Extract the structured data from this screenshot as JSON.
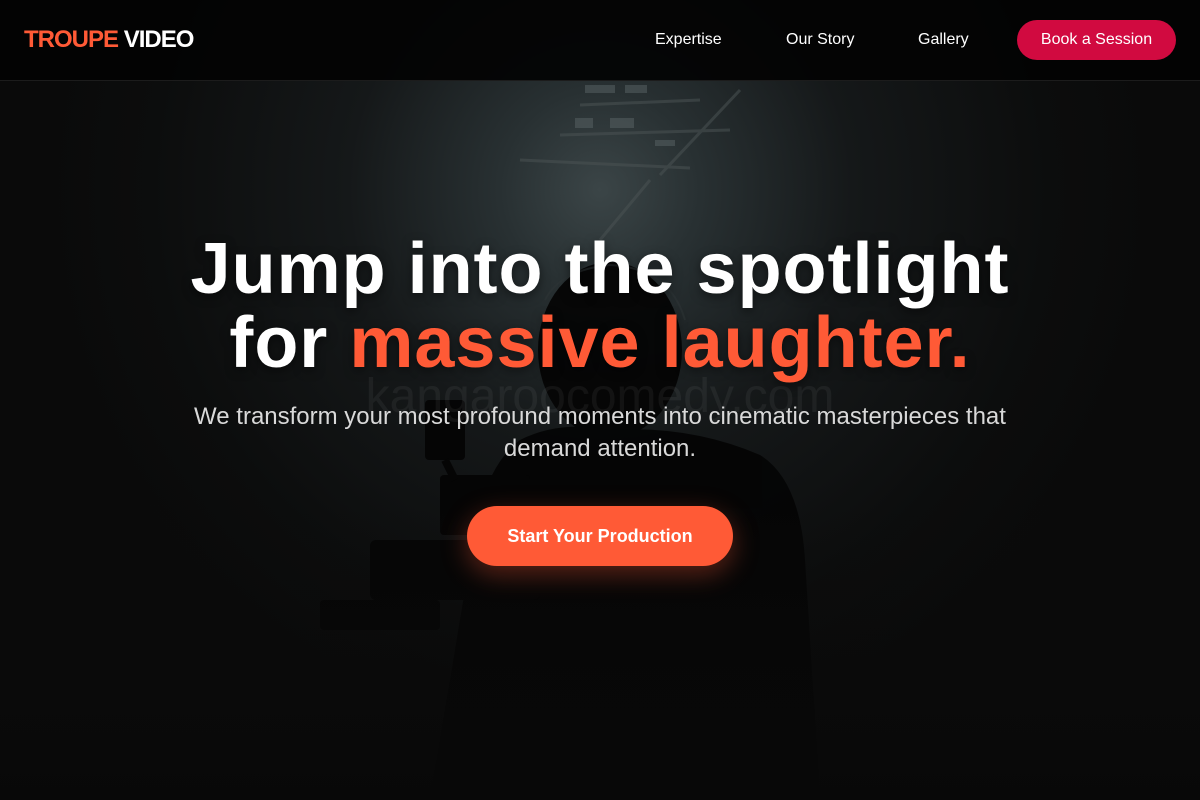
{
  "brand": {
    "logo_accent": "TROUPE",
    "logo_rest": "VIDEO",
    "accent_color": "#ff5a36",
    "cta_secondary_color": "#d10a40"
  },
  "nav": {
    "links": [
      {
        "label": "Expertise"
      },
      {
        "label": "Our Story"
      },
      {
        "label": "Gallery"
      }
    ],
    "cta_label": "Book a Session"
  },
  "hero": {
    "headline_line1": "Jump into the spotlight",
    "headline_plain": "for",
    "headline_accent": "massive laughter.",
    "subtitle": "We transform your most profound moments into cinematic masterpieces that demand attention.",
    "cta_label": "Start Your Production",
    "background_image": "silhouette-camera-operator"
  }
}
